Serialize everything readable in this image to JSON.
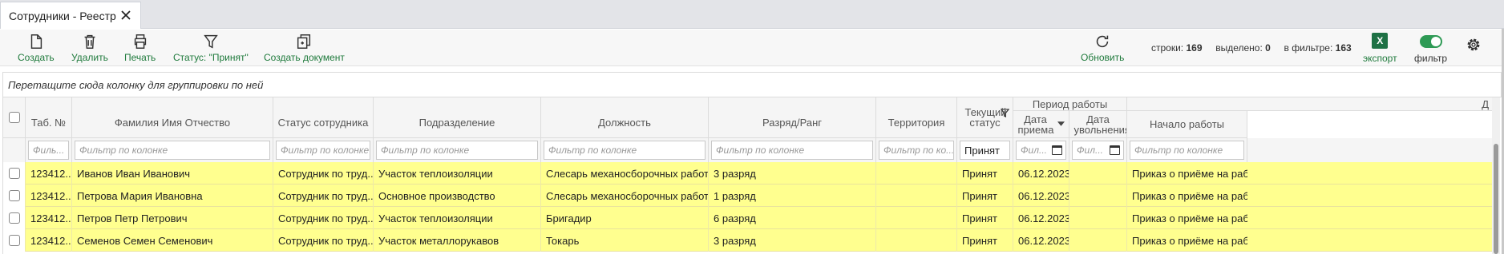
{
  "tab": {
    "title": "Сотрудники - Реестр"
  },
  "toolbar": {
    "create": "Создать",
    "delete": "Удалить",
    "print": "Печать",
    "status_filter": "Статус: \"Принят\"",
    "create_document": "Создать документ",
    "refresh": "Обновить",
    "export": "экспорт",
    "filter": "фильтр",
    "excel_letter": "X"
  },
  "stats": {
    "rows_label": "строки:",
    "rows_value": "169",
    "selected_label": "выделено:",
    "selected_value": "0",
    "filtered_label": "в фильтре:",
    "filtered_value": "163"
  },
  "group_panel": "Перетащите сюда колонку для группировки по ней",
  "columns": {
    "tab_no": "Таб. №",
    "fio": "Фамилия Имя Отчество",
    "status": "Статус сотрудника",
    "department": "Подразделение",
    "position": "Должность",
    "rank": "Разряд/Ранг",
    "territory": "Территория",
    "current_status": "Текущий статус",
    "period": "Период работы",
    "hire_date": "Дата приема",
    "fire_date": "Дата увольнения",
    "start_work": "Начало работы",
    "cut_letter": "Д"
  },
  "filters": {
    "tab_no": "Филь...",
    "fio": "Фильтр по колонке",
    "status": "Фильтр по колонке",
    "department": "Фильтр по колонке",
    "position": "Фильтр по колонке",
    "rank": "Фильтр по колонке",
    "territory": "Фильтр по ко...",
    "current_status": "Принят",
    "hire_date": "Фил...",
    "fire_date": "Фил...",
    "start_work": "Фильтр по колонке"
  },
  "rows": [
    {
      "tab_no": "123412...",
      "fio": "Иванов Иван Иванович",
      "status": "Сотрудник по труд...",
      "department": "Участок теплоизоляции",
      "position": "Слесарь механосборочных работ",
      "rank": "3 разряд",
      "territory": "",
      "current_status": "Принят",
      "hire_date": "06.12.2023",
      "fire_date": "",
      "start_work": "Приказ о приёме на работу"
    },
    {
      "tab_no": "123412...",
      "fio": "Петрова Мария Ивановна",
      "status": "Сотрудник по труд...",
      "department": "Основное производство",
      "position": "Слесарь механосборочных работ",
      "rank": "1 разряд",
      "territory": "",
      "current_status": "Принят",
      "hire_date": "06.12.2023",
      "fire_date": "",
      "start_work": "Приказ о приёме на работу"
    },
    {
      "tab_no": "123412...",
      "fio": "Петров Петр Петрович",
      "status": "Сотрудник по труд...",
      "department": "Участок теплоизоляции",
      "position": "Бригадир",
      "rank": "6 разряд",
      "territory": "",
      "current_status": "Принят",
      "hire_date": "06.12.2023",
      "fire_date": "",
      "start_work": "Приказ о приёме на работу"
    },
    {
      "tab_no": "123412...",
      "fio": "Семенов Семен Семенович",
      "status": "Сотрудник по труд...",
      "department": "Участок металлорукавов",
      "position": "Токарь",
      "rank": "3 разряд",
      "territory": "",
      "current_status": "Принят",
      "hire_date": "06.12.2023",
      "fire_date": "",
      "start_work": "Приказ о приёме на работу"
    }
  ]
}
